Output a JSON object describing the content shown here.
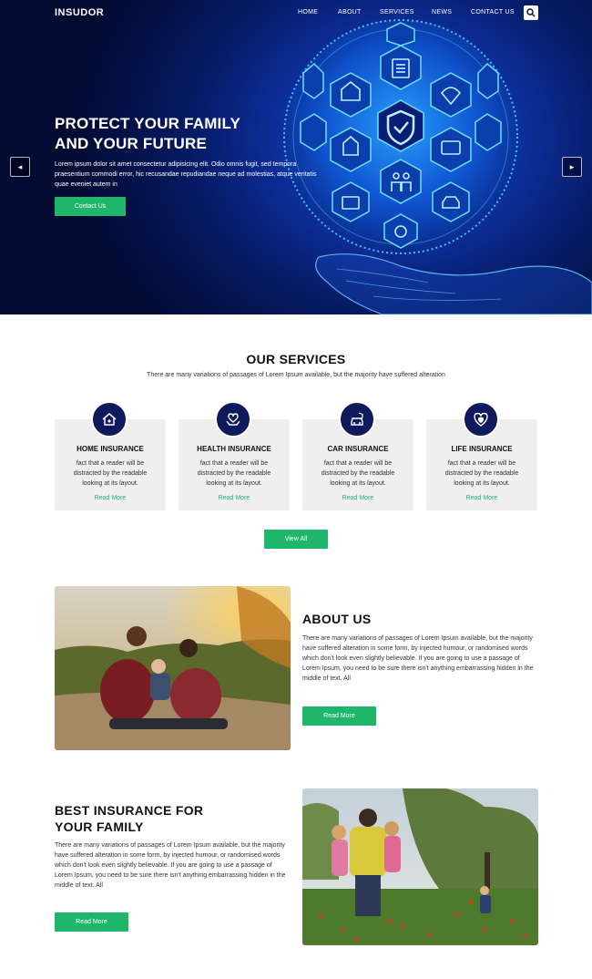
{
  "header": {
    "logo": "INSUDOR",
    "nav": [
      "HOME",
      "ABOUT",
      "SERVICES",
      "NEWS",
      "CONTACT US"
    ]
  },
  "hero": {
    "title_line1": "PROTECT YOUR FAMILY",
    "title_line2": "AND YOUR FUTURE",
    "text": "Lorem ipsum dolor sit amet consectetur adipisicing elit. Odio omnis fugit, sed tempora praesentium commodi error, hic recusandae repudiandae neque ad molestias, atque veritatis quae eveniet autem in",
    "button": "Contact Us",
    "prev_arrow": "◂",
    "next_arrow": "▸"
  },
  "services": {
    "title": "OUR SERVICES",
    "subtitle": "There are many variations of passages of Lorem Ipsum available, but the majority have suffered alteration",
    "cards": [
      {
        "title": "HOME INSURANCE",
        "text": "fact that a reader will be distracted by the readable looking at its layout.",
        "link": "Read More",
        "icon": "house-icon"
      },
      {
        "title": "HEALTH INSURANCE",
        "text": "fact that a reader will be distracted by the readable looking at its layout.",
        "link": "Read More",
        "icon": "health-hands-icon"
      },
      {
        "title": "CAR INSURANCE",
        "text": "fact that a reader will be distracted by the readable looking at its layout.",
        "link": "Read More",
        "icon": "car-shield-icon"
      },
      {
        "title": "LIFE INSURANCE",
        "text": "fact that a reader will be distracted by the readable looking at its layout.",
        "link": "Read More",
        "icon": "heart-shield-icon"
      }
    ],
    "view_all": "View All"
  },
  "about": {
    "title": "ABOUT US",
    "text": "There are many variations of passages of Lorem Ipsum available, but the majority have suffered alteration in some form, by injected humour, or randomised words which don't look even slightly believable. If you are going to use a passage of Lorem Ipsum, you need to be sure there isn't anything embarrassing hidden in the middle of text. All",
    "button": "Read More"
  },
  "best": {
    "title_line1": "BEST INSURANCE FOR",
    "title_line2": "YOUR FAMILY",
    "text": "There are many variations of passages of Lorem Ipsum available, but the majority have suffered alteration in some form, by injected humour, or randomised words which don't look even slightly believable. If you are going to use a passage of Lorem Ipsum, you need to be sure there isn't anything embarrassing hidden in the middle of text. All",
    "button": "Read More"
  },
  "colors": {
    "accent": "#1fb56a",
    "navy": "#0e1a5c",
    "card_bg": "#efefef"
  }
}
